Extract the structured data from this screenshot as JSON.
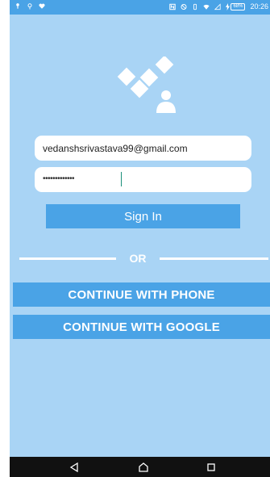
{
  "status_bar": {
    "time": "20:26",
    "battery": "68%",
    "left_icons": [
      "notification-icon",
      "location-icon",
      "heart-icon"
    ],
    "right_icons": [
      "nfc-icon",
      "dnd-icon",
      "vibrate-icon",
      "wifi-icon",
      "signal-icon",
      "battery-icon"
    ]
  },
  "login": {
    "email_value": "vedanshsrivastava99@gmail.com",
    "password_mask": "•••••••••••••",
    "sign_in_label": "Sign In",
    "divider_text": "OR",
    "phone_button_label": "CONTINUE WITH PHONE",
    "google_button_label": "CONTINUE WITH GOOGLE"
  },
  "nav_bar": {
    "icons": [
      "back-icon",
      "home-icon",
      "recents-icon"
    ]
  },
  "colors": {
    "background": "#a9d4f5",
    "accent": "#4aa3e6",
    "field": "#ffffff",
    "nav_bar": "#111111"
  }
}
